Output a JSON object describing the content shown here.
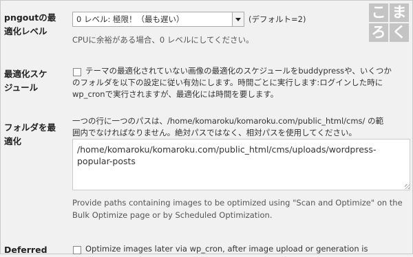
{
  "png_setting": {
    "label_line1": "pngoutの最",
    "label_line2": "適化レベル",
    "selected": "0 レベル: 極限！（最も遅い）",
    "default_hint": "(デフォルト=2)",
    "description": "CPUに余裕がある場合、0 レベルにしてください。"
  },
  "schedule_setting": {
    "label_line1": "最適化スケ",
    "label_line2": "ジュール",
    "line1": "テーマの最適化されていない画像の最適化のスケジュールをbuddypressや、いくつか",
    "line2": "のフォルダを以下の設定に従い有効にします。時間ごとに実行します:ログインした時に",
    "line3": "wp_cronで実行されますが、最適化には時間を要します。"
  },
  "folder_setting": {
    "label_line1": "フォルダを最",
    "label_line2": "適化",
    "intro_line1": "一つの行に一つのパスは、/home/komaroku/komaroku.com/public_html/cms/ の範",
    "intro_line2": "囲内でなければなりません。絶対パスではなく、相対パスを使用してください。",
    "textarea_value": "/home/komaroku/komaroku.com/public_html/cms/uploads/wordpress-popular-posts",
    "help_line1": "Provide paths containing images to be optimized using \"Scan and Optimize\" on the",
    "help_line2": "Bulk Optimize page or by Scheduled Optimization."
  },
  "deferred_setting": {
    "label": "Deferred",
    "text": "Optimize images later via wp_cron, after image upload or generation is"
  },
  "logo": {
    "chars": [
      "こ",
      "ま",
      "ろ",
      "く"
    ]
  }
}
